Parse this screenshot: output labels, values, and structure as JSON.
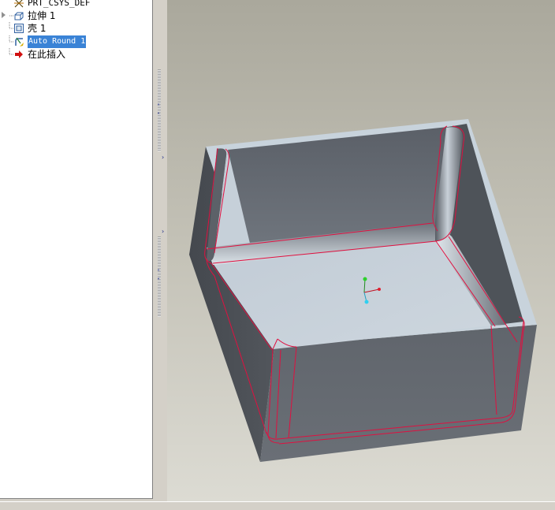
{
  "model_tree": {
    "items": [
      {
        "label": "PRT_CSYS_DEF",
        "icon": "csys-icon",
        "expandable": false,
        "selected": false
      },
      {
        "label": "拉伸 1",
        "icon": "extrude-icon",
        "expandable": true,
        "selected": false
      },
      {
        "label": "壳 1",
        "icon": "shell-icon",
        "expandable": false,
        "selected": false
      },
      {
        "label": "Auto Round 1",
        "icon": "round-icon",
        "expandable": false,
        "selected": true
      },
      {
        "label": "在此插入",
        "icon": "insert-arrow-icon",
        "expandable": false,
        "selected": false
      }
    ]
  },
  "colors": {
    "selection": "#3a83d6",
    "highlight_edge": "#e01040",
    "model_face_light": "#c5cfd8",
    "model_face_dark": "#5f646b",
    "viewport_top": "#aaa89c",
    "viewport_bottom": "#dcdbd3"
  }
}
